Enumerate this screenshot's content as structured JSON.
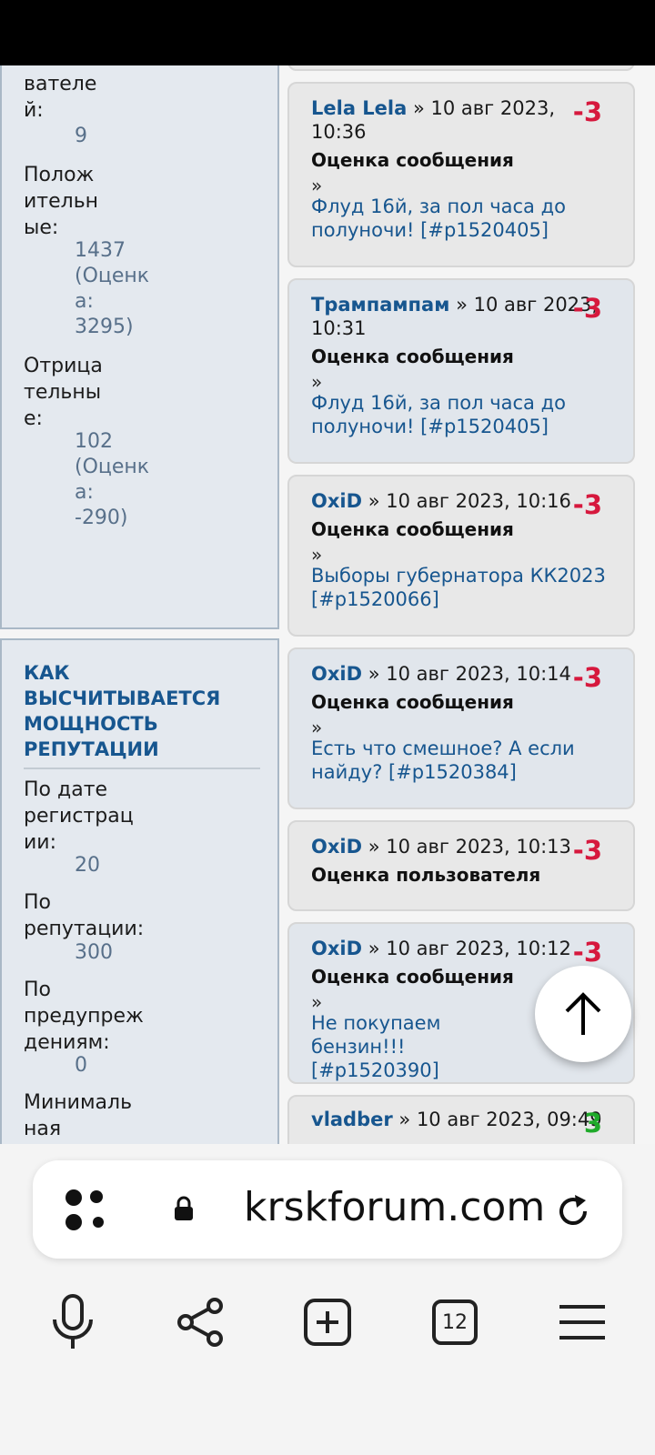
{
  "browser": {
    "url": "krskforum.com",
    "tabs_count": "12",
    "icons": [
      "apps-icon",
      "lock-icon",
      "reload-icon",
      "microphone-icon",
      "share-icon",
      "new-tab-icon",
      "tabs-icon",
      "menu-icon"
    ]
  },
  "left_panel_stats": {
    "partial_label": "вателе\nй:",
    "partial_value": "9",
    "positive_label": "Полож\nительн\nые:",
    "positive_value": "1437\n(Оценк\nа:\n3295)",
    "negative_label": "Отрица\nтельны\nе:",
    "negative_value": "102\n(Оценк\nа:\n-290)"
  },
  "power_panel": {
    "title": "КАК ВЫСЧИТЫВАЕТСЯ МОЩНОСТЬ РЕПУТАЦИИ",
    "items": [
      {
        "label": "По дате\nрегистрац\nии:",
        "value": "20"
      },
      {
        "label": "По\nрепутации:",
        "value": "300"
      },
      {
        "label": "По\nпредупреж\nдениям:",
        "value": "0"
      },
      {
        "label": "Минималь\nная\nмощность\nрепутации",
        "value": ""
      }
    ]
  },
  "reputation_entries": [
    {
      "author": "Lela Lela",
      "date": "» 10 авг 2023,\n10:36",
      "type": "Оценка сообщения",
      "arrow": "»",
      "topic": "Флуд 16й, за пол часа до полуночи! [#p1520405]",
      "score": "-3"
    },
    {
      "author": "Трампампам",
      "date": "» 10 авг 2023,\n10:31",
      "type": "Оценка сообщения",
      "arrow": "»",
      "topic": "Флуд 16й, за пол часа до полуночи! [#p1520405]",
      "score": "-3"
    },
    {
      "author": "OxiD",
      "date": "» 10 авг 2023, 10:16",
      "type": "Оценка сообщения",
      "arrow": "»",
      "topic": "Выборы губернатора КК2023 [#p1520066]",
      "score": "-3"
    },
    {
      "author": "OxiD",
      "date": "» 10 авг 2023, 10:14",
      "type": "Оценка сообщения",
      "arrow": "»",
      "topic": "Есть что смешное? А если найду? [#p1520384]",
      "score": "-3"
    },
    {
      "author": "OxiD",
      "date": "» 10 авг 2023, 10:13",
      "type": "Оценка пользователя",
      "arrow": "",
      "topic": "",
      "score": "-3"
    },
    {
      "author": "OxiD",
      "date": "» 10 авг 2023, 10:12",
      "type": "Оценка сообщения",
      "arrow": "»",
      "topic": "Не покупаем бензин!!!\n[#p1520390]",
      "score": "-3"
    },
    {
      "author": "vladber",
      "date": "» 10 авг 2023, 09:49",
      "type": "",
      "arrow": "",
      "topic": "",
      "score": "3"
    }
  ],
  "colors": {
    "link": "#17568f",
    "negative": "#d6183d",
    "positive": "#1faa2a",
    "panel_bg": "#e4e9ef"
  }
}
